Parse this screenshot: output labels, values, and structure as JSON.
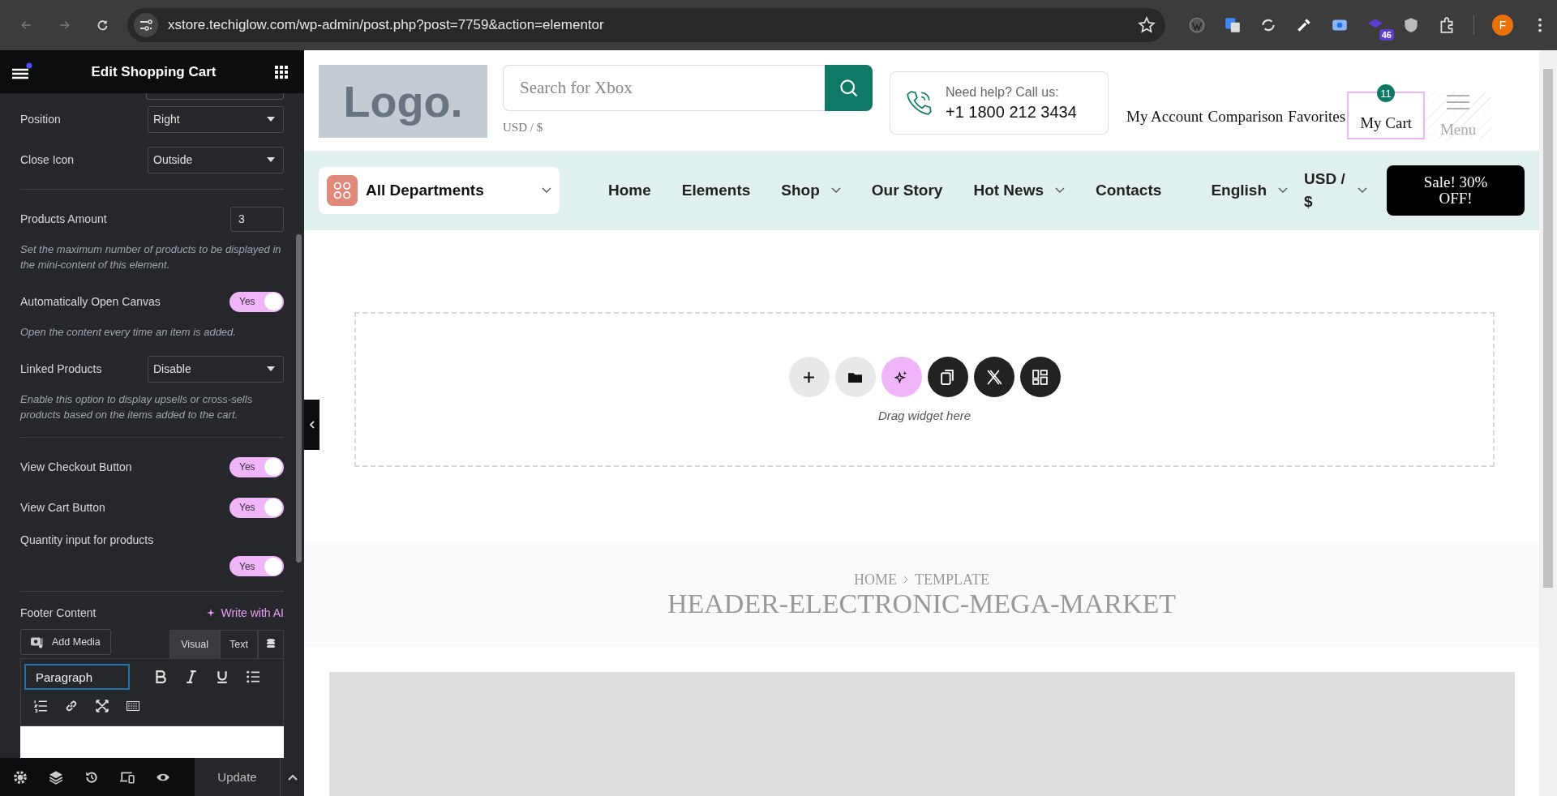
{
  "browser": {
    "url": "xstore.techiglow.com/wp-admin/post.php?post=7759&action=elementor",
    "extension_badge": "46",
    "avatar": "F"
  },
  "editor": {
    "title": "Edit Shopping Cart",
    "controls": [
      {
        "kind": "select",
        "label": "Position",
        "value": "Right"
      },
      {
        "kind": "select",
        "label": "Close Icon",
        "value": "Outside"
      },
      {
        "kind": "divider"
      },
      {
        "kind": "number",
        "label": "Products Amount",
        "value": "3"
      },
      {
        "kind": "note",
        "text": "Set the maximum number of products to be displayed in the mini-content of this element."
      },
      {
        "kind": "toggle",
        "label": "Automatically Open Canvas",
        "on": true,
        "text": "Yes"
      },
      {
        "kind": "note",
        "text": "Open the content every time an item is added."
      },
      {
        "kind": "select",
        "label": "Linked Products",
        "value": "Disable"
      },
      {
        "kind": "note",
        "text": "Enable this option to display upsells or cross-sells products based on the items added to the cart."
      },
      {
        "kind": "divider"
      },
      {
        "kind": "toggle",
        "label": "View Checkout Button",
        "on": true,
        "text": "Yes"
      },
      {
        "kind": "toggle",
        "label": "View Cart Button",
        "on": true,
        "text": "Yes"
      },
      {
        "kind": "stacked_toggle",
        "label": "Quantity input for products",
        "on": true,
        "text": "Yes"
      },
      {
        "kind": "divider"
      }
    ],
    "footer_content": {
      "label": "Footer Content",
      "ai_link": "Write with AI",
      "add_media": "Add Media",
      "tabs": [
        {
          "label": "Visual",
          "selected": true
        },
        {
          "label": "Text",
          "selected": false
        }
      ],
      "format": "Paragraph"
    },
    "update": "Update"
  },
  "site": {
    "logo": "Logo.",
    "search": {
      "placeholder": "Search for Xbox"
    },
    "currency": "USD / $",
    "help": {
      "label": "Need help? Call us:",
      "phone": "+1 1800 212 3434"
    },
    "account_links": [
      "My Account",
      "Comparison",
      "Favorites"
    ],
    "cart": {
      "label": "My Cart",
      "count": "11"
    },
    "menu": "Menu",
    "departments": "All Departments",
    "nav": [
      {
        "label": "Home",
        "dropdown": false
      },
      {
        "label": "Elements",
        "dropdown": false
      },
      {
        "label": "Shop",
        "dropdown": true
      },
      {
        "label": "Our Story",
        "dropdown": false
      },
      {
        "label": "Hot News",
        "dropdown": true
      },
      {
        "label": "Contacts",
        "dropdown": false
      }
    ],
    "nav_right": [
      {
        "label": "English",
        "dropdown": true
      },
      {
        "label": "USD / $",
        "dropdown": true
      }
    ],
    "sale": "Sale! 30% OFF!",
    "dropzone": "Drag widget here",
    "breadcrumb": [
      "HOME",
      "TEMPLATE"
    ],
    "page_title": "HEADER-ELECTRONIC-MEGA-MARKET"
  }
}
